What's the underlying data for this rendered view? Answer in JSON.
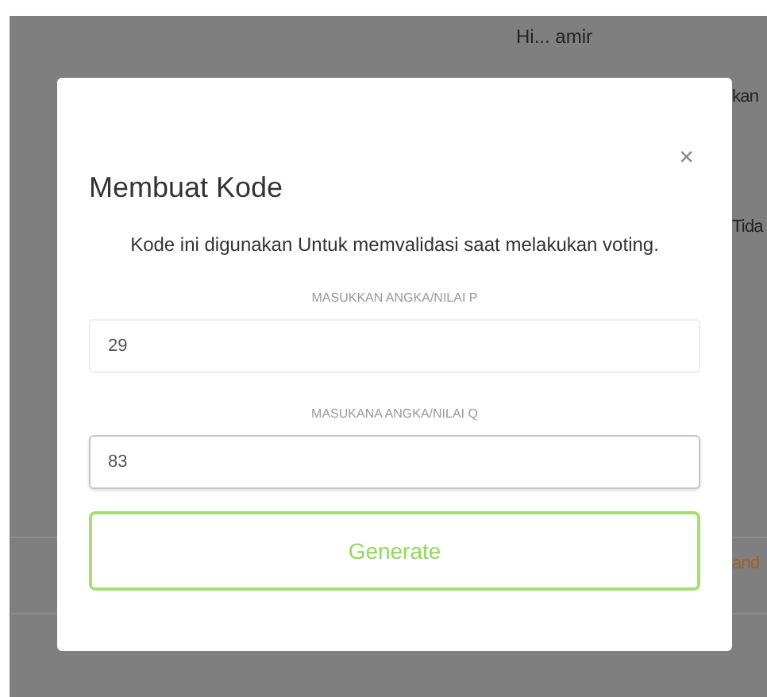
{
  "background": {
    "greeting": "Hi... amir",
    "side_texts": [
      {
        "text": "kan",
        "kind": "plain"
      },
      {
        "text": "Tida",
        "kind": "plain"
      },
      {
        "text": "and",
        "kind": "link"
      }
    ]
  },
  "modal": {
    "title": "Membuat Kode",
    "close": "×",
    "description": "Kode ini digunakan Untuk memvalidasi saat melakukan voting.",
    "fields": [
      {
        "label": "MASUKKAN ANGKA/NILAI P",
        "value": "29",
        "focused": false
      },
      {
        "label": "MASUKANA ANGKA/NILAI Q",
        "value": "83",
        "focused": true
      }
    ],
    "button": "Generate"
  }
}
